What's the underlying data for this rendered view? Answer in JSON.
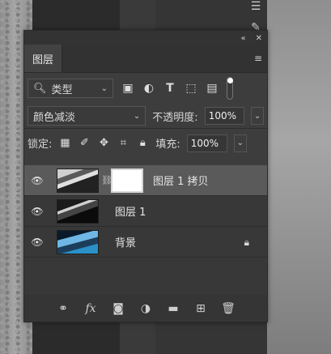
{
  "panel": {
    "collapse_icon": "collapse-icon",
    "close_icon": "close-icon",
    "tab_label": "图层",
    "menu_icon": "panel-menu-icon"
  },
  "filter": {
    "type_label": "类型",
    "icons": [
      "image-filter-icon",
      "adjustment-filter-icon",
      "type-filter-icon",
      "shape-filter-icon",
      "smart-object-filter-icon"
    ]
  },
  "blend": {
    "mode": "颜色减淡",
    "opacity_label": "不透明度:",
    "opacity_value": "100%"
  },
  "lock": {
    "label": "锁定:",
    "fill_label": "填充:",
    "fill_value": "100%"
  },
  "layers": [
    {
      "name": "图层 1 拷贝",
      "selected": true,
      "has_mask": true
    },
    {
      "name": "图层 1",
      "selected": false,
      "has_mask": false
    },
    {
      "name": "背景",
      "selected": false,
      "locked": true
    }
  ],
  "bottom_icons": [
    "link-layers-icon",
    "fx-icon",
    "add-mask-icon",
    "adjustment-layer-icon",
    "group-folder-icon",
    "new-layer-icon",
    "trash-icon"
  ],
  "fx_label": "fx"
}
